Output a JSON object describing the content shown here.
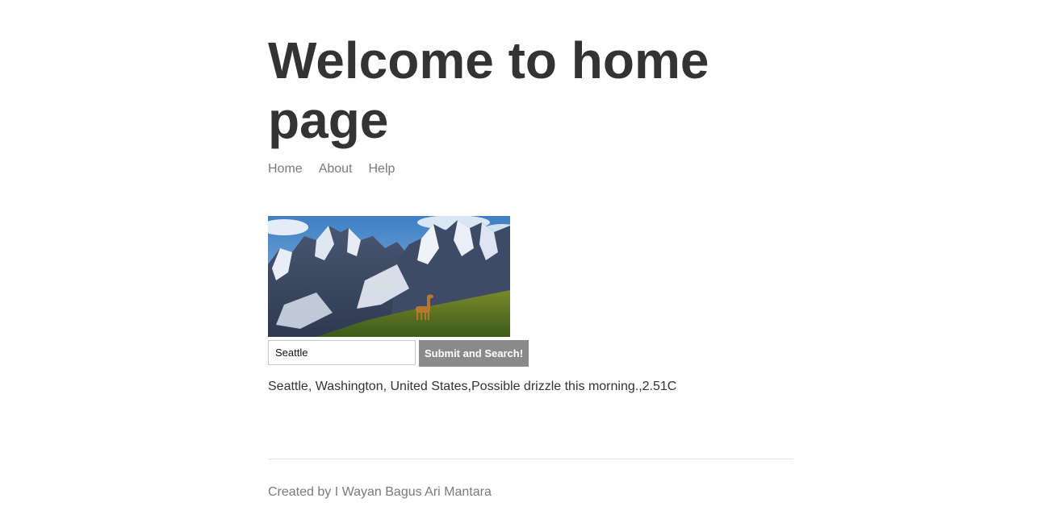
{
  "header": {
    "title": "Welcome to home page"
  },
  "nav": {
    "items": [
      {
        "label": "Home"
      },
      {
        "label": "About"
      },
      {
        "label": "Help"
      }
    ]
  },
  "search": {
    "value": "Seattle",
    "button_label": "Submit and Search!"
  },
  "result": {
    "text": "Seattle, Washington, United States,Possible drizzle this morning.,2.51C"
  },
  "footer": {
    "text": "Created by I Wayan Bagus Ari Mantara"
  },
  "colors": {
    "heading": "#333333",
    "nav_link": "#7a7a7a",
    "button_bg": "#8a8a8a",
    "button_text": "#ffffff",
    "divider": "#e6e6e6"
  }
}
